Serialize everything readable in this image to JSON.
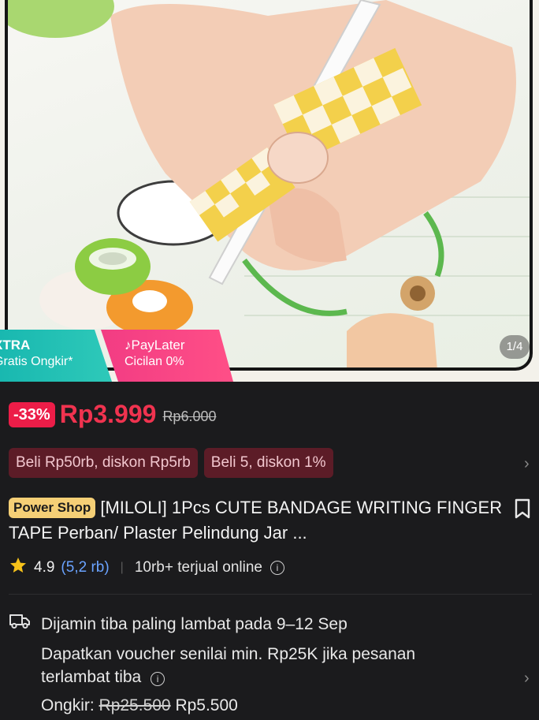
{
  "image": {
    "counter": "1/4",
    "promo": {
      "left_title": "XTRA",
      "left_sub": "Gratis Ongkir*",
      "right_title": "PayLater",
      "right_sub": "Cicilan 0%"
    }
  },
  "price": {
    "discount": "-33%",
    "current": "Rp3.999",
    "original": "Rp6.000"
  },
  "vouchers": [
    "Beli Rp50rb, diskon Rp5rb",
    "Beli 5, diskon 1%"
  ],
  "product": {
    "badge": "Power Shop",
    "title": "[MILOLI] 1Pcs CUTE BANDAGE WRITING FINGER TAPE Perban/ Plaster Pelindung Jar ..."
  },
  "rating": {
    "score": "4.9",
    "count": "(5,2 rb)",
    "sold": "10rb+ terjual online"
  },
  "shipping": {
    "guarantee": "Dijamin tiba paling lambat pada 9–12 Sep",
    "voucher_note": "Dapatkan voucher senilai min. Rp25K jika pesanan",
    "voucher_note_2": "terlambat tiba",
    "ongkir_label": "Ongkir:",
    "ongkir_old": "Rp25.500",
    "ongkir_new": "Rp5.500"
  }
}
